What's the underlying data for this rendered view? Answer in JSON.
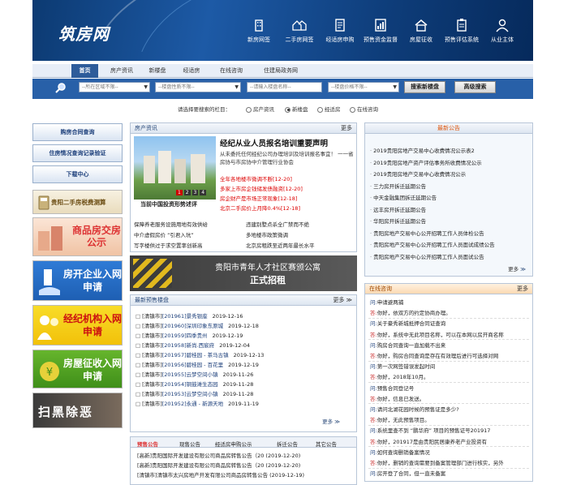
{
  "logo": "筑房网",
  "top_nav": [
    "新房网签",
    "二手房网签",
    "经适房申购",
    "预售资金监督",
    "房屋征收",
    "预售评估系统",
    "从业主体"
  ],
  "main_nav": [
    "首页",
    "房产资讯",
    "新楼盘",
    "经适房",
    "在线咨询",
    "住建局政务网"
  ],
  "search": {
    "area": "--所在区域不限--",
    "type": "--楼盘性质不限--",
    "name_placeholder": "--请输入楼盘名称--",
    "price": "--楼盘价格不限--",
    "btn_search": "搜索新楼盘",
    "btn_adv": "高级搜索"
  },
  "radio": {
    "label": "请选择要搜索的栏目：",
    "options": [
      "房产资讯",
      "新楼盘",
      "经适房",
      "在线咨询"
    ]
  },
  "left": {
    "links": [
      "购房合同查询",
      "住房情况查询记录验证",
      "下载中心"
    ],
    "banners": [
      "贵阳二手房税费测算",
      "商品房交房公示",
      "房开企业入网申请",
      "经纪机构入网申请",
      "房屋征收入网申请",
      "扫黑除恶"
    ]
  },
  "news": {
    "title": "房产资讯",
    "more": "更多",
    "headline": "经纪从业人员报名培训重要声明",
    "desc": "从未委托任何经纪公司办理培训及培训报名事宜！ 一一省房协与市房协中介管理行业协会",
    "photo_caption": "当前中国投资形势述评",
    "pages": [
      "1",
      "2",
      "3",
      "4"
    ],
    "red_items": [
      {
        "t": "全年各地楼市微调不断",
        "d": "[12-20]"
      },
      {
        "t": "多家上市房企钱储发债融资",
        "d": "[12-20]"
      },
      {
        "t": "房企财产是市场正常现象",
        "d": "[12-18]"
      },
      {
        "t": "北京二手房价上月降0.4%",
        "d": "[12-18]"
      }
    ],
    "items": [
      [
        "保障养老服务设施用地有效供给",
        "违建别墅点杀全广禁而不绝"
      ],
      [
        "中介虚假房价 “引君入坑”",
        "多地楼市政策微调"
      ],
      [
        "写字楼供过于求空置率创新高",
        "北京房租跌至近两年最长水平"
      ]
    ]
  },
  "ad": {
    "line1": "贵阳市青年人才社区赛颁公寓",
    "line2": "正式招租"
  },
  "presale": {
    "title": "最新预售楼盘",
    "more": "更多 ≫",
    "items": [
      {
        "r": "[清镇市]",
        "n": "[201961]景秀银座",
        "d": "2019-12-16"
      },
      {
        "r": "[清镇市]",
        "n": "[201960]深圳印象东原城",
        "d": "2019-12-18"
      },
      {
        "r": "[清镇市]",
        "n": "[201959]四季贵州",
        "d": "2019-12-19"
      },
      {
        "r": "[清镇市]",
        "n": "[201958]新尚.西宸府",
        "d": "2019-12-04"
      },
      {
        "r": "[清镇市]",
        "n": "[201957]碧桂园 - 茶马古镇",
        "d": "2019-12-13"
      },
      {
        "r": "[清镇市]",
        "n": "[201956]碧桂园 - 百花里",
        "d": "2019-12-19"
      },
      {
        "r": "[清镇市]",
        "n": "[201955]云梦空间小镇",
        "d": "2019-11-26"
      },
      {
        "r": "[清镇市]",
        "n": "[201954]铜鼓滩生态园",
        "d": "2019-11-28"
      },
      {
        "r": "[清镇市]",
        "n": "[201953]云梦空间小镇",
        "d": "2019-11-28"
      },
      {
        "r": "[清镇市]",
        "n": "[201952]永通 - 新源天地",
        "d": "2019-11-19"
      }
    ]
  },
  "tabs": {
    "labels": [
      "预售公告",
      "现售公告",
      "经适房申购公示",
      "拆迁公告",
      "其它公告"
    ],
    "items": [
      "[高新]贵阳国际开发建设有限公司商品房转售公告（20 (2019-12-20)",
      "[高新]贵阳国际开发建设有限公司商品房转售公告（20 (2019-12-20)",
      "[清镇市]清镇市太兴房地产开发有限公司商品房转售公告 (2019-12-19)"
    ]
  },
  "announce": {
    "title": "最新公告",
    "more": "更多",
    "items": [
      "2019贵阳房地产交易中心收费情况公示表2",
      "2019贵阳房地产资产评估事务所收费情况公示",
      "2019贵阳房地产交易中心收费情况公示",
      "三力房开拆迁延期公告",
      "中天金融集团拆迁延期公告",
      "远丰房开拆迁延期公告",
      "华阳房开拆迁延期公告",
      "贵阳房地产交易中心公开招聘工作人员体检公告",
      "贵阳房地产交易中心公开招聘工作人员面试成绩公告",
      "贵阳房地产交易中心公开招聘工作人员面试公告"
    ]
  },
  "consult": {
    "title": "在线咨询",
    "more": "更多",
    "items": [
      [
        "问:",
        "申请避两捕"
      ],
      [
        "答:",
        "你好，依双方的约定协商办理。"
      ],
      [
        "问:",
        "关于豪秀新城抵押合同证查询"
      ],
      [
        "答:",
        "你好，系统中无此项目名称，可以在本网以房开商名称"
      ],
      [
        "问:",
        "购房合同查询一直加载不出来"
      ],
      [
        "答:",
        "你好，购房合同查询是存在有效理后进行可选择对网"
      ],
      [
        "问:",
        "第一次网签错误发起时间"
      ],
      [
        "答:",
        "你好，2018年10月。"
      ],
      [
        "问:",
        "预售合同登记号"
      ],
      [
        "答:",
        "你好，信息已发送。"
      ],
      [
        "问:",
        "请问北湖花园时候的预售证是多少?"
      ],
      [
        "答:",
        "你好，无此预售项目。"
      ],
      [
        "问:",
        "系统里查不到 “鹏华府” 项目的预售证号201917"
      ],
      [
        "答:",
        "你好，201917是由贵阳民居康养老产业投资有"
      ],
      [
        "问:",
        "如何查询删销备案情况"
      ],
      [
        "答:",
        "你好，删销的查询需要到备案管理部门进行核实，另外"
      ],
      [
        "问:",
        "房开登了合同，但一直未备案"
      ]
    ]
  }
}
